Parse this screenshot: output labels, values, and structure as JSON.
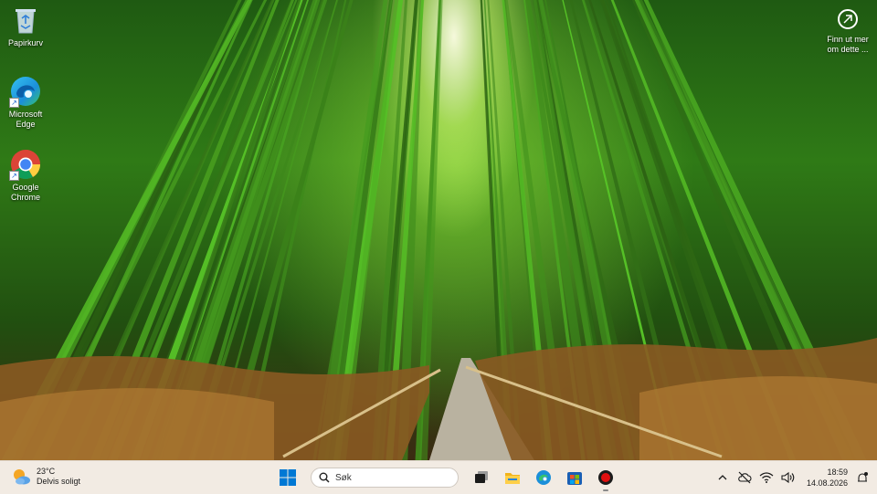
{
  "desktop": {
    "icons": [
      {
        "label": "Papirkurv",
        "icon": "recycle-bin-icon"
      },
      {
        "label": "Microsoft Edge",
        "icon": "edge-icon"
      },
      {
        "label": "Google Chrome",
        "icon": "chrome-icon"
      }
    ],
    "spotlight": {
      "label": "Finn ut mer om dette ...",
      "icon": "info-circle-icon"
    }
  },
  "taskbar": {
    "weather": {
      "temp": "23°C",
      "condition": "Delvis soligt",
      "icon": "sun-cloud-icon"
    },
    "start_icon": "windows-start-icon",
    "search": {
      "placeholder": "Søk",
      "icon": "search-icon"
    },
    "pinned": [
      {
        "name": "task-view",
        "icon": "task-view-icon"
      },
      {
        "name": "file-explorer",
        "icon": "folder-icon"
      },
      {
        "name": "microsoft-edge",
        "icon": "edge-icon"
      },
      {
        "name": "microsoft-store",
        "icon": "store-icon"
      },
      {
        "name": "record-app",
        "icon": "record-icon"
      }
    ],
    "tray": {
      "icons": [
        "chevron-up-icon",
        "network-off-icon",
        "wifi-icon",
        "volume-icon"
      ],
      "time": "18:59",
      "date": "14.08.2026",
      "notification_icon": "notification-icon"
    }
  },
  "colors": {
    "taskbar_bg": "#f2ebe3",
    "windows_blue": "#0078d4",
    "record_red": "#e01010"
  }
}
